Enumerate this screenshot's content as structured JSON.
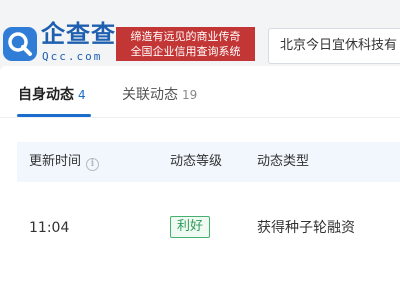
{
  "header": {
    "logo_text": "企查查",
    "logo_domain": "Qcc.com",
    "slogan_line1": "缔造有远见的商业传奇",
    "slogan_line2": "全国企业信用查询系统",
    "search_value": "北京今日宜休科技有"
  },
  "tabs": [
    {
      "label": "自身动态",
      "count": "4",
      "active": true
    },
    {
      "label": "关联动态",
      "count": "19",
      "active": false
    }
  ],
  "table": {
    "columns": [
      "更新时间",
      "动态等级",
      "动态类型"
    ],
    "info_icon": "i",
    "rows": [
      {
        "time": "11:04",
        "level": "利好",
        "type": "获得种子轮融资"
      }
    ]
  },
  "colors": {
    "brand_blue": "#1f5fb0",
    "slogan_red": "#c33636",
    "active_tab": "#1a6dcc",
    "badge_green": "#2f9b58"
  }
}
